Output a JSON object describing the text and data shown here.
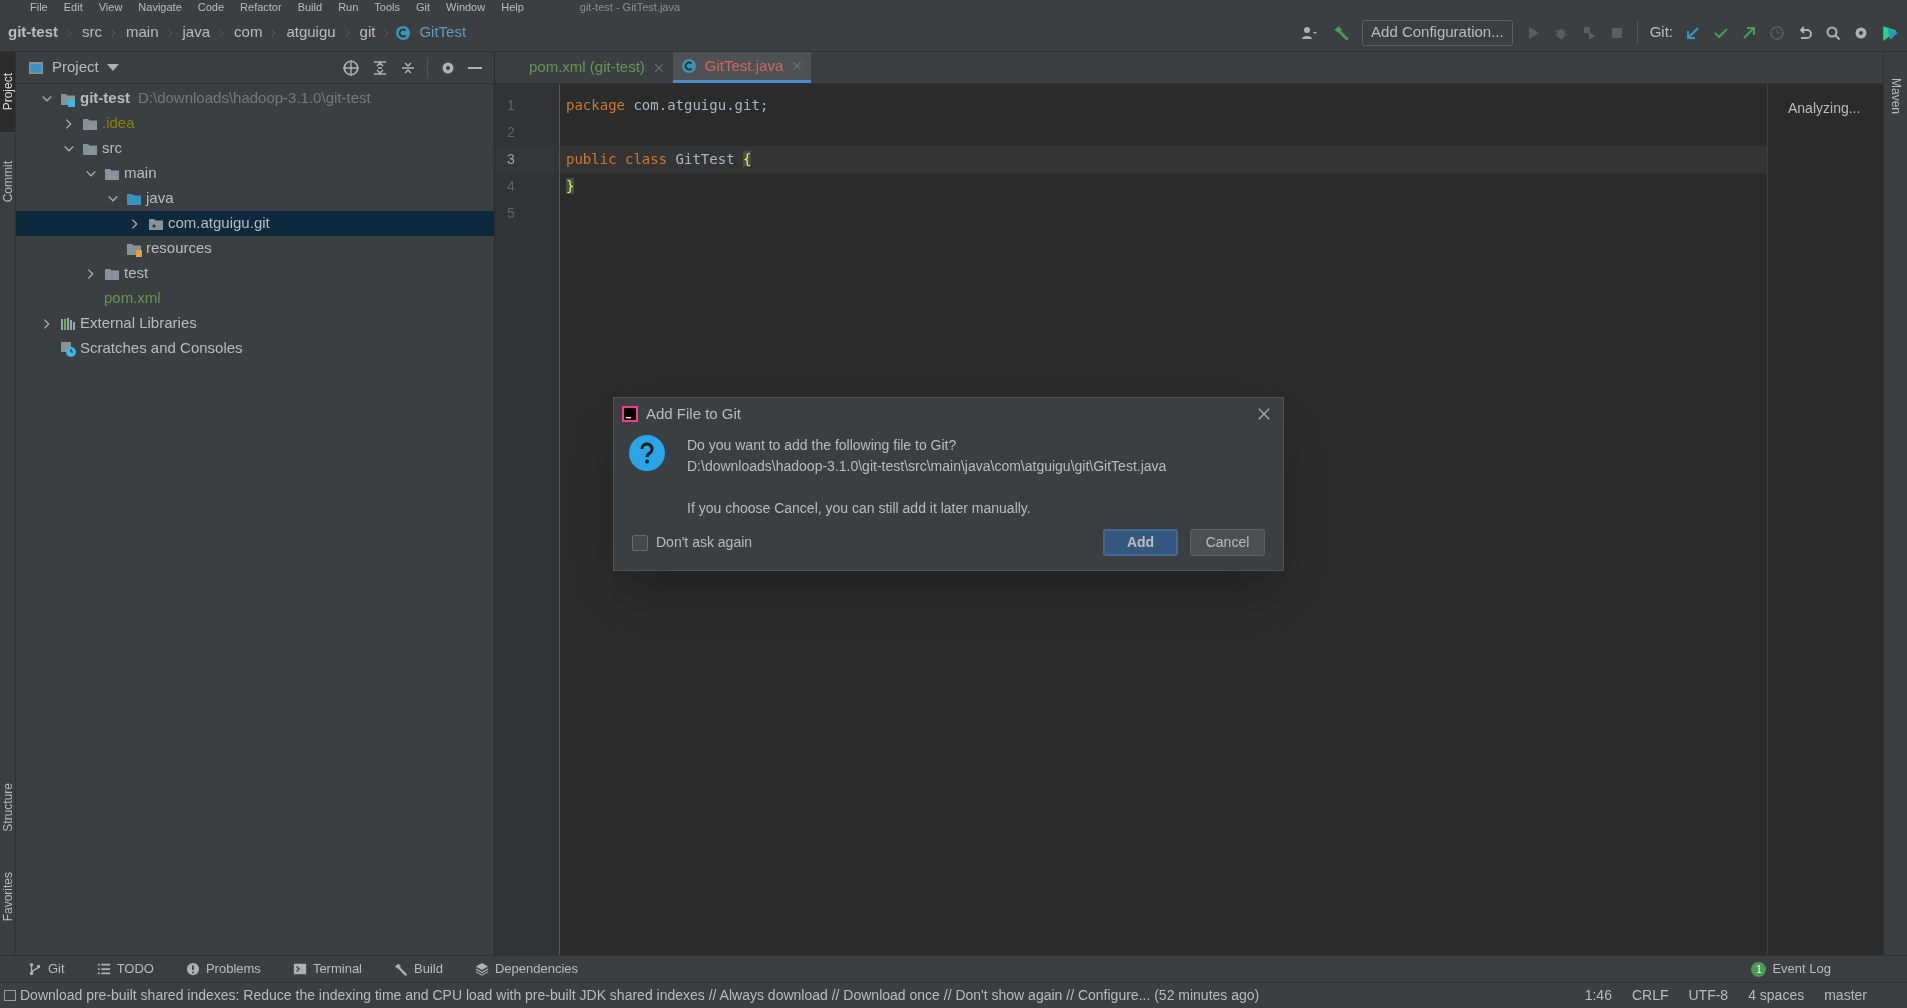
{
  "window": {
    "title": "git-test - GitTest.java"
  },
  "menu": [
    "File",
    "Edit",
    "View",
    "Navigate",
    "Code",
    "Refactor",
    "Build",
    "Run",
    "Tools",
    "Git",
    "Window",
    "Help"
  ],
  "breadcrumbs": [
    {
      "label": "git-test",
      "kind": "project"
    },
    {
      "label": "src",
      "kind": "dir"
    },
    {
      "label": "main",
      "kind": "dir"
    },
    {
      "label": "java",
      "kind": "dir"
    },
    {
      "label": "com",
      "kind": "dir"
    },
    {
      "label": "atguigu",
      "kind": "dir"
    },
    {
      "label": "git",
      "kind": "dir"
    },
    {
      "label": "GitTest",
      "kind": "class"
    }
  ],
  "toolbar": {
    "run_config": "Add Configuration...",
    "git_label": "Git:"
  },
  "left_stripe": [
    {
      "label": "Project",
      "selected": true
    },
    {
      "label": "Commit",
      "selected": false
    }
  ],
  "left_stripe_bottom": [
    {
      "label": "Structure",
      "selected": false
    },
    {
      "label": "Favorites",
      "selected": false
    }
  ],
  "project_panel": {
    "title": "Project",
    "tree": [
      {
        "label": "git-test",
        "path": "D:\\downloads\\hadoop-3.1.0\\git-test",
        "kind": "module",
        "expanded": true,
        "selected": false,
        "children": [
          {
            "label": ".idea",
            "kind": "folder",
            "color": "#848504",
            "expanded": false,
            "selected": false
          },
          {
            "label": "src",
            "kind": "folder",
            "expanded": true,
            "selected": false,
            "children": [
              {
                "label": "main",
                "kind": "folder",
                "expanded": true,
                "selected": false,
                "children": [
                  {
                    "label": "java",
                    "kind": "source",
                    "expanded": true,
                    "selected": false,
                    "children": [
                      {
                        "label": "com.atguigu.git",
                        "kind": "package",
                        "expanded": false,
                        "selected": true
                      }
                    ]
                  },
                  {
                    "label": "resources",
                    "kind": "resources",
                    "selected": false
                  }
                ]
              },
              {
                "label": "test",
                "kind": "folder",
                "expanded": false,
                "selected": false
              }
            ]
          },
          {
            "label": "pom.xml",
            "kind": "maven",
            "color": "#629755",
            "selected": false
          }
        ]
      },
      {
        "label": "External Libraries",
        "kind": "libraries",
        "expanded": false,
        "selected": false
      },
      {
        "label": "Scratches and Consoles",
        "kind": "scratches",
        "selected": false
      }
    ]
  },
  "tabs": [
    {
      "label": "pom.xml (git-test)",
      "kind": "maven",
      "color": "#629755",
      "selected": false
    },
    {
      "label": "GitTest.java",
      "kind": "class",
      "color": "#d1675a",
      "selected": true
    }
  ],
  "editor": {
    "lines": [
      {
        "number": "1",
        "current": false,
        "tokens": [
          {
            "text": "package",
            "kind": "keyword"
          },
          {
            "text": " com.atguigu.git;",
            "kind": "plain"
          }
        ]
      },
      {
        "number": "2",
        "current": false
      },
      {
        "number": "3",
        "current": true,
        "tokens": [
          {
            "text": "public",
            "kind": "keyword"
          },
          {
            "text": " class",
            "kind": "keyword"
          },
          {
            "text": " GitTest ",
            "kind": "plain"
          },
          {
            "text": "{",
            "kind": "brace_match"
          }
        ]
      },
      {
        "number": "4",
        "current": false,
        "tokens": [
          {
            "text": "}",
            "kind": "brace_match"
          }
        ]
      },
      {
        "number": "5",
        "current": false
      }
    ],
    "status_text": "Analyzing..."
  },
  "right_stripe": [
    {
      "label": "Maven",
      "selected": false
    }
  ],
  "dialog": {
    "title": "Add File to Git",
    "message": "Do you want to add the following file to Git?",
    "path": "D:\\downloads\\hadoop-3.1.0\\git-test\\src\\main\\java\\com\\atguigu\\git\\GitTest.java",
    "hint": "If you choose Cancel, you can still add it later manually.",
    "checkbox": {
      "label": "Don't ask again",
      "checked": false
    },
    "buttons": [
      {
        "label": "Add",
        "default": true
      },
      {
        "label": "Cancel",
        "default": false
      }
    ]
  },
  "bottom_tools": [
    {
      "label": "Git",
      "kind": "git"
    },
    {
      "label": "TODO",
      "kind": "todo"
    },
    {
      "label": "Problems",
      "kind": "problems"
    },
    {
      "label": "Terminal",
      "kind": "terminal"
    },
    {
      "label": "Build",
      "kind": "build"
    },
    {
      "label": "Dependencies",
      "kind": "dependencies"
    }
  ],
  "event_log": {
    "label": "Event Log",
    "count": "1"
  },
  "status_bar": {
    "message": "Download pre-built shared indexes: Reduce the indexing time and CPU load with pre-built JDK shared indexes // Always download // Download once // Don't show again // Configure... (52 minutes ago)",
    "items": [
      "1:46",
      "CRLF",
      "UTF-8",
      "4 spaces",
      "master"
    ]
  }
}
